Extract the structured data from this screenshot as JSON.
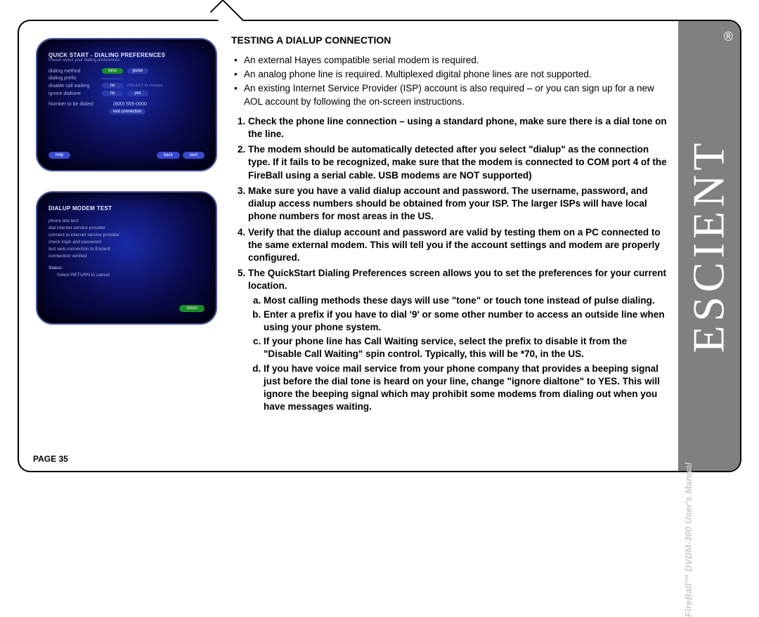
{
  "brand": "ESCIENT",
  "registered_symbol": "®",
  "product_line": "FireBall™ DVDM-300 User's Manual",
  "page_label": "PAGE 35",
  "title": "TESTING A DIALUP CONNECTION",
  "intro_bullets": [
    "An external Hayes compatible serial modem is required.",
    "An analog phone line is required. Multiplexed digital phone lines are not supported.",
    "An existing Internet Service Provider (ISP) account is also required – or you can sign up for a new AOL account by following the on-screen instructions."
  ],
  "steps": [
    "Check the phone line connection – using a standard phone, make sure there is a dial tone on the line.",
    "The modem should be automatically detected after you select \"dialup\" as the connection type. If it fails to be recognized, make sure that the modem is connected to COM port 4 of the FireBall using a serial cable. USB modems are NOT supported)",
    "Make sure you have a valid dialup account and password. The username, password, and dialup access numbers should be obtained from your ISP. The larger ISPs will have local phone numbers for most areas in the US.",
    "Verify that the dialup account and password are valid by testing them on a PC connected to the same external modem. This will tell you if the account settings and modem are properly configured.",
    "The QuickStart Dialing Preferences screen allows you to set the preferences for your current location."
  ],
  "substeps": [
    "Most calling methods these days will use \"tone\" or touch tone instead of pulse dialing.",
    "Enter a prefix if you have to dial '9' or some other number to access an outside line when using your phone system.",
    "If your phone line has Call Waiting service, select the prefix to disable it from the \"Disable Call Waiting\" spin control. Typically, this will be *70, in the US.",
    "If you have voice mail service from your phone company that provides a beeping signal just before the dial tone is heard on your line, change \"ignore dialtone\" to YES. This will ignore the beeping signal which may prohibit some modems from dialing out when you have messages waiting."
  ],
  "screen1": {
    "header": "QUICK START - DIALING PREFERENCES",
    "subheader": "Please select your dialing preferences.",
    "rows": [
      {
        "label": "dialing method",
        "value": "tone",
        "alt": "pulse"
      },
      {
        "label": "dialing prefix",
        "value": ""
      },
      {
        "label": "disable call waiting",
        "value": "no",
        "hint": "(SELECT to change)"
      },
      {
        "label": "ignore dialtone",
        "value": "no",
        "alt": "yes"
      }
    ],
    "numline_label": "Number to be dialed:",
    "numline_value": "(800) 555-0000",
    "test_label": "test connection",
    "buttons": [
      "help",
      "",
      "back",
      "next"
    ]
  },
  "screen2": {
    "header": "DIALUP MODEM TEST",
    "lines": [
      "phone line test",
      "dial internet service provider",
      "connect to internet service provider",
      "check login and password",
      "test web connection to Escient",
      "connection verified"
    ],
    "status_label": "Status:",
    "status_text": "Select RETURN to cancel",
    "return_btn": "return"
  }
}
